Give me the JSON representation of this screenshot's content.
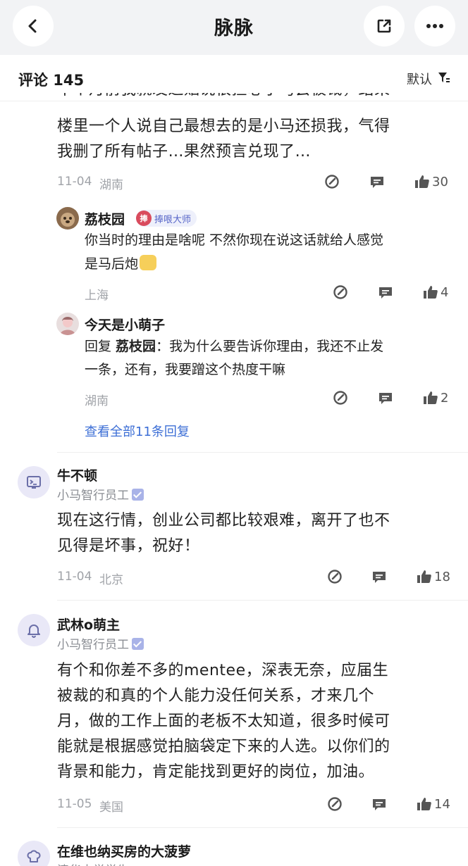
{
  "header": {
    "title": "脉脉",
    "back_icon": "back-arrow-icon",
    "share_icon": "share-external-icon",
    "more_icon": "more-dots-icon"
  },
  "comments_bar": {
    "title": "评论 145",
    "sort_label": "默认",
    "sort_icon": "sort-filter-icon"
  },
  "thread1": {
    "partial_top": "半个月前我就发过贴说很担心小马会被裁，结果",
    "lines": [
      "楼里一个人说自己最想去的是小马还损我，气得",
      "我删了所有帖子…果然预言兑现了…"
    ],
    "date": "11-04",
    "location": "湖南",
    "likes": "30",
    "replies": [
      {
        "user": "荔枝园",
        "badge": "捧哏大师",
        "text1": "你当时的理由是啥呢 不然你现在说这话就给人感觉",
        "text2": "是马后炮",
        "location": "上海",
        "likes": "4"
      },
      {
        "user": "今天是小萌子",
        "reply_prefix": "回复 ",
        "reply_to": "荔枝园",
        "text1_rest": "：我为什么要告诉你理由，我还不止发",
        "text2": "一条，还有，我要蹭这个热度干嘛",
        "location": "湖南",
        "likes": "2"
      }
    ],
    "view_all": "查看全部11条回复"
  },
  "comment2": {
    "user": "牛不顿",
    "subtitle": "小马智行员工",
    "lines": [
      "现在这行情，创业公司都比较艰难，离开了也不",
      "见得是坏事，祝好！"
    ],
    "date": "11-04",
    "location": "北京",
    "likes": "18"
  },
  "comment3": {
    "user": "武林o萌主",
    "subtitle": "小马智行员工",
    "lines": [
      "有个和你差不多的mentee，深表无奈，应届生",
      "被裁的和真的个人能力没任何关系，才来几个",
      "月，做的工作上面的老板不太知道，很多时候可",
      "能就是根据感觉拍脑袋定下来的人选。以你们的",
      "背景和能力，肯定能找到更好的岗位，加油。"
    ],
    "date": "11-05",
    "location": "美国",
    "likes": "14"
  },
  "comment4": {
    "user": "在维也纳买房的大菠萝",
    "subtitle": "清华大学学生"
  },
  "colors": {
    "link": "#3d6fd6",
    "topbar_bg": "#f2f3f5",
    "meta": "#a0a3a8"
  }
}
